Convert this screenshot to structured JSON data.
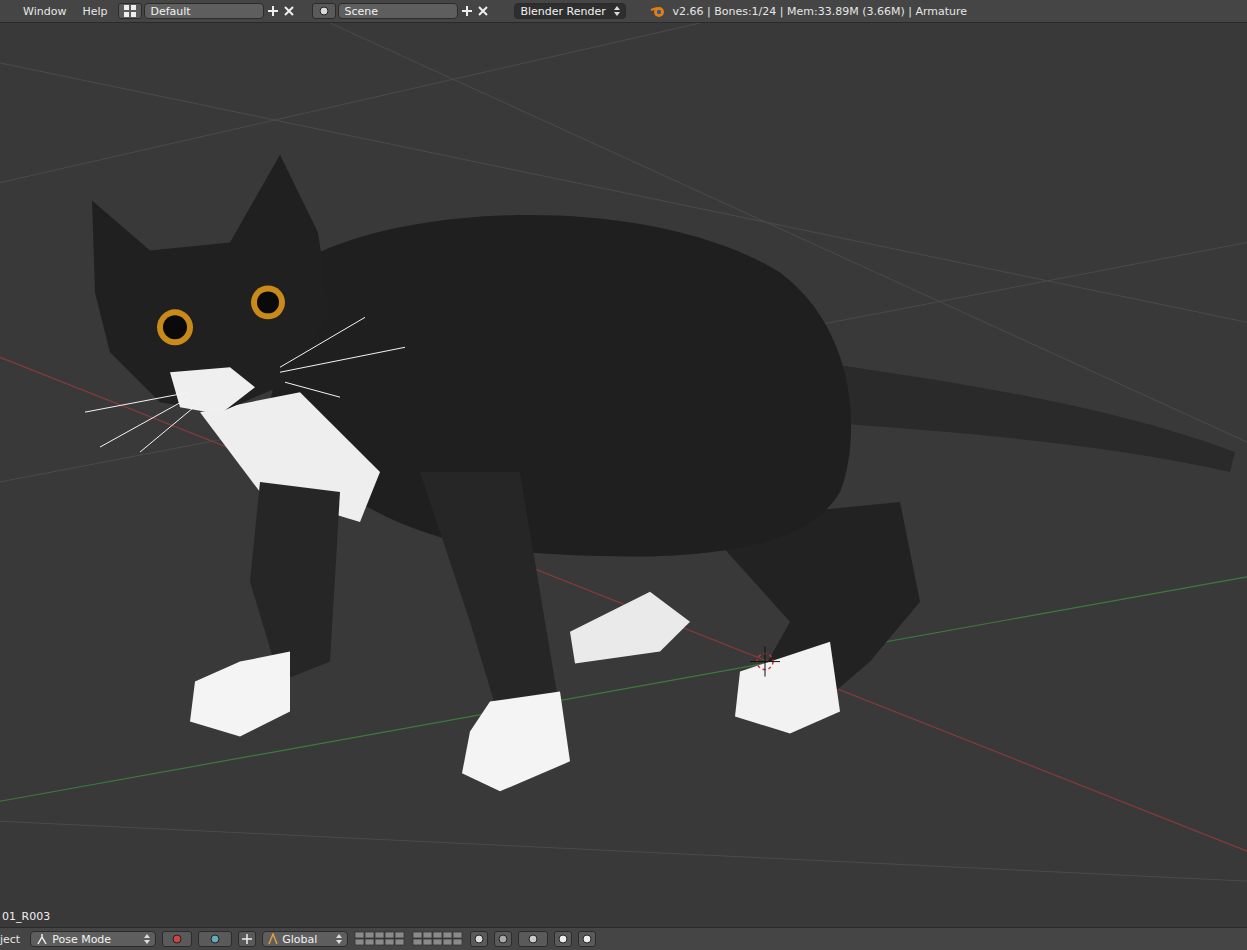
{
  "header": {
    "menus": [
      "Window",
      "Help"
    ],
    "screen_layout": "Default",
    "scene": "Scene",
    "render_engine": "Blender Render",
    "info": "v2.66 | Bones:1/24  | Mem:33.89M (3.66M) | Armature"
  },
  "viewport": {
    "object_label": "01_R003"
  },
  "footer": {
    "menu_cut": "ject",
    "mode": "Pose Mode",
    "orientation": "Global"
  }
}
